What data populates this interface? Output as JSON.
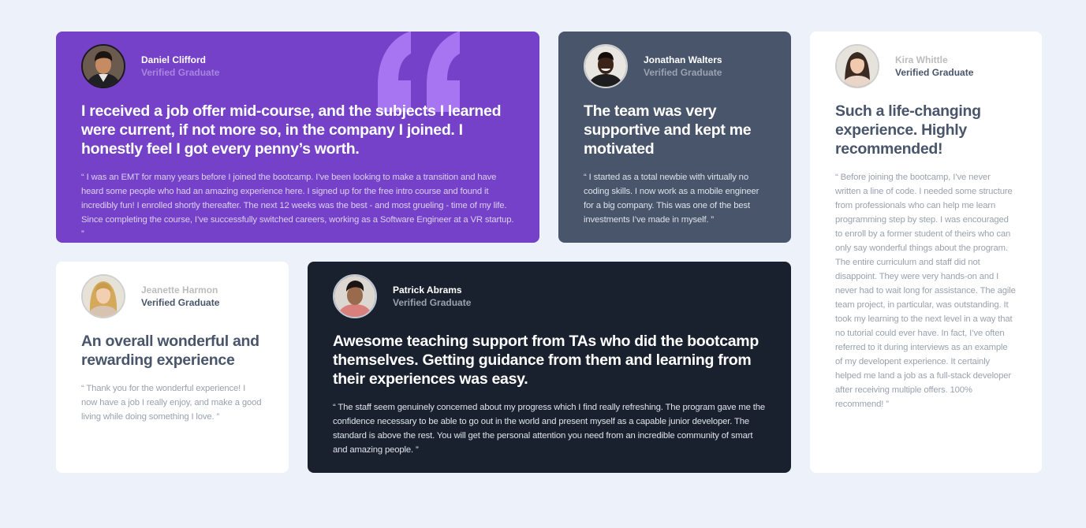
{
  "testimonials": [
    {
      "name": "Daniel Clifford",
      "role": "Verified Graduate",
      "headline": "I received a job offer mid-course, and the subjects I learned were current, if not more so, in the company I joined. I honestly feel I got every penny’s worth.",
      "body": "“ I was an EMT for many years before I joined the bootcamp. I’ve been looking to make a transition and have heard some people who had an amazing experience here. I signed up for the free intro course and found it incredibly fun! I enrolled shortly thereafter. The next 12 weeks was the best - and most grueling - time of my life. Since completing the course, I’ve successfully switched careers, working as a Software Engineer at a VR startup. ”",
      "background": "#7541c8"
    },
    {
      "name": "Jonathan Walters",
      "role": "Verified Graduate",
      "headline": "The team was very supportive and kept me motivated",
      "body": "“ I started as a total newbie with virtually no coding skills. I now work as a mobile engineer for a big company. This was one of the best investments I’ve made in myself. ”",
      "background": "#48556a"
    },
    {
      "name": "Kira Whittle",
      "role": "Verified Graduate",
      "headline": "Such a life-changing experience. Highly recommended!",
      "body": "“ Before joining the bootcamp, I’ve never written a line of code. I needed some structure from professionals who can help me learn programming step by step. I was encouraged to enroll by a former student of theirs who can only say wonderful things about the program. The entire curriculum and staff did not disappoint. They were very hands-on and I never had to wait long for assistance. The agile team project, in particular, was outstanding. It took my learning to the next level in a way that no tutorial could ever have. In fact, I’ve often referred to it during interviews as an example of my developent experience. It certainly helped me land a job as a full-stack developer after receiving multiple offers. 100% recommend! ”",
      "background": "#ffffff"
    },
    {
      "name": "Jeanette Harmon",
      "role": "Verified Graduate",
      "headline": "An overall wonderful and rewarding experience",
      "body": "“ Thank you for the wonderful experience! I now have a job I really enjoy, and make a good living while doing something I love. ”",
      "background": "#ffffff"
    },
    {
      "name": "Patrick Abrams",
      "role": "Verified Graduate",
      "headline": "Awesome teaching support from TAs who did the bootcamp themselves. Getting guidance from them and learning from their experiences was easy.",
      "body": "“ The staff seem genuinely concerned about my progress which I find really refreshing. The program gave me the confidence necessary to be able to go out in the world and present myself as a capable junior developer. The standard is above the rest. You will get the personal attention you need from an incredible community of smart and amazing people. ”",
      "background": "#19212e"
    }
  ],
  "icons": {
    "quote": "quotation-mark-icon",
    "quote_color": "#a775f1"
  }
}
